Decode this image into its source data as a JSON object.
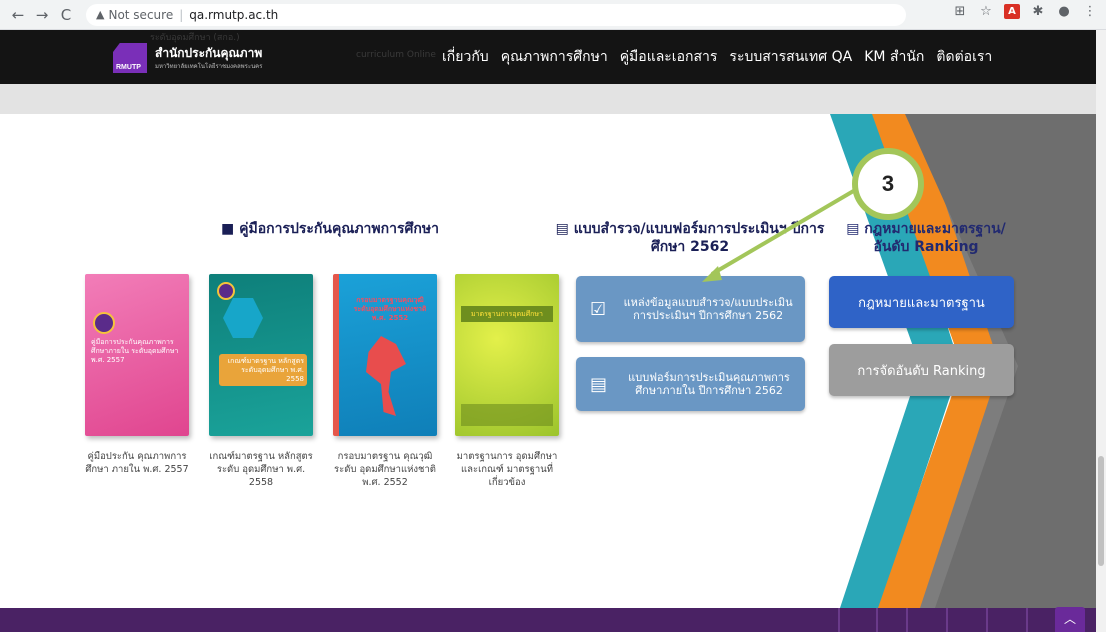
{
  "browser": {
    "back": "←",
    "forward": "→",
    "reload": "C",
    "security": "Not secure",
    "url": "qa.rmutp.ac.th"
  },
  "header": {
    "logo_badge": "RMUTP",
    "logo_title": "สำนักประกันคุณภาพ",
    "logo_subtitle": "มหาวิทยาลัยเทคโนโลยีราชมงคลพระนคร",
    "ghost_1": "ระดับอุดมศึกษา (สกอ.)",
    "ghost_2": "curriculum Online",
    "menu": [
      "เกี่ยวกับ",
      "คุณภาพการศึกษา",
      "คู่มือและเอกสาร",
      "ระบบสารสนเทศ QA",
      "KM สำนัก",
      "ติดต่อเรา"
    ]
  },
  "sections": {
    "manuals_title": "คู่มือการประกันคุณภาพการศึกษา",
    "forms_title": "แบบสำรวจ/แบบฟอร์มการประเมินฯ ปีการศึกษา 2562",
    "law_title": "กฎหมายและมาตรฐาน/ อันดับ Ranking"
  },
  "books": [
    {
      "cover": "คู่มือการประกันคุณภาพการศึกษาภายใน ระดับอุดมศึกษา พ.ศ. 2557",
      "caption": "คู่มือประกัน คุณภาพการศึกษา ภายใน พ.ศ. 2557"
    },
    {
      "cover": "เกณฑ์มาตรฐาน หลักสูตรระดับอุดมศึกษา พ.ศ. 2558",
      "caption": "เกณฑ์มาตรฐาน หลักสูตรระดับ อุดมศึกษา พ.ศ. 2558"
    },
    {
      "cover": "กรอบมาตรฐานคุณวุฒิ ระดับอุดมศึกษาแห่งชาติ พ.ศ. 2552",
      "caption": "กรอบมาตรฐาน คุณวุฒิระดับ อุดมศึกษาแห่งชาติ พ.ศ. 2552"
    },
    {
      "cover": "มาตรฐานการอุดมศึกษา",
      "caption": "มาตรฐานการ อุดมศึกษาและเกณฑ์ มาตรฐานที่เกี่ยวข้อง"
    }
  ],
  "buttons": {
    "survey_source": "แหล่งข้อมูลแบบสำรวจ/แบบประเมินการประเมินฯ ปีการศึกษา 2562",
    "qa_form": "แบบฟอร์มการประเมินคุณภาพการศึกษาภายใน ปีการศึกษา 2562",
    "law": "กฎหมายและมาตรฐาน",
    "ranking": "การจัดอันดับ Ranking"
  },
  "callout_number": "3",
  "icons": {
    "book": "book-icon",
    "clipboard": "clipboard-check-icon",
    "form": "form-icon",
    "list": "list-icon",
    "up": "chevron-up-icon"
  },
  "colors": {
    "header_bg": "#141414",
    "brand_purple": "#7a2fb8",
    "button_blue": "#6a97c4",
    "law_blue": "#2f63c7",
    "ranking_grey": "#9d9d9d",
    "chevron_teal": "#2aa7b7",
    "chevron_orange": "#f28a1f",
    "callout_green": "#a3c65a",
    "footer": "#4a2264"
  }
}
